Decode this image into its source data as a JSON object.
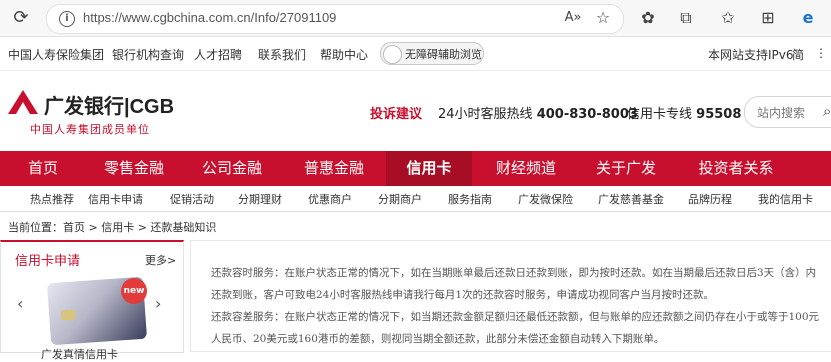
{
  "browser": {
    "url": "https://www.cgbchina.com.cn/Info/27091109",
    "icons": [
      "reload-icon",
      "info-icon",
      "read-aloud-icon",
      "favorite-add-icon",
      "extension-icon",
      "puzzle-icon",
      "favorites-icon",
      "collections-icon",
      "edge-icon"
    ]
  },
  "topbar": {
    "links": [
      "中国人寿保险集团",
      "银行机构查询",
      "人才招聘",
      "联系我们",
      "帮助中心"
    ],
    "accessibility_label": "无障碍辅助浏览",
    "ipv6": "本网站支持IPv6",
    "lang": "简"
  },
  "header": {
    "logo_text": "广发银行|CGB",
    "logo_sub": "中国人寿集团成员单位",
    "complaint": "投诉建议",
    "hotline_label": "24小时客服热线",
    "hotline_number": "400-830-8003",
    "cardline_label": "信用卡专线",
    "cardline_number": "95508",
    "search_placeholder": "站内搜索"
  },
  "mainnav": [
    "首页",
    "零售金融",
    "公司金融",
    "普惠金融",
    "信用卡",
    "财经频道",
    "关于广发",
    "投资者关系"
  ],
  "mainnav_active": "信用卡",
  "subnav": [
    "热点推荐",
    "信用卡申请",
    "促销活动",
    "分期理财",
    "优惠商户",
    "分期商户",
    "服务指南",
    "广发微保险",
    "广发慈善基金",
    "品牌历程",
    "我的信用卡"
  ],
  "breadcrumb": "当前位置：首页 > 信用卡 > 还款基础知识",
  "panel": {
    "title": "信用卡申请",
    "more": "更多>",
    "badge": "new",
    "card_name": "广发真情信用卡"
  },
  "content": {
    "lines": [
      "还款容时服务：在账户状态正常的情况下，如在当期账单最后还款日还款到账，即为按时还款。如在当期最后还款日后3天（含）内",
      "还款到账，客户可致电24小时客服热线申请我行每月1次的还款容时服务，申请成功视同客户当月按时还款。",
      "还款容差服务：在账户状态正常的情况下，如当期还款金额足额归还最低还款额，但与账单的应还款额之间仍存在小于或等于100元",
      "人民币、20美元或160港币的差额，则视同当期全额还款，此部分未偿还金额自动转入下期账单。"
    ]
  },
  "colors": {
    "brand_red": "#c8102e"
  }
}
